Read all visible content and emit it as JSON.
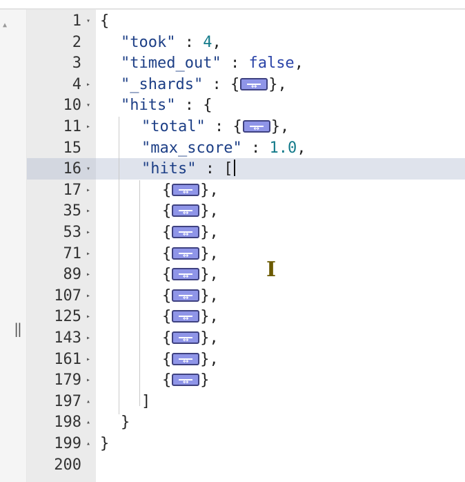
{
  "editor": {
    "lines": [
      {
        "num": "1",
        "fold": "▾",
        "indent": 0,
        "tokens": [
          {
            "t": "{",
            "c": "punc"
          }
        ]
      },
      {
        "num": "2",
        "fold": "",
        "indent": 1,
        "tokens": [
          {
            "t": "\"took\"",
            "c": "key"
          },
          {
            "t": " : ",
            "c": "punc"
          },
          {
            "t": "4",
            "c": "num"
          },
          {
            "t": ",",
            "c": "punc"
          }
        ]
      },
      {
        "num": "3",
        "fold": "",
        "indent": 1,
        "tokens": [
          {
            "t": "\"timed_out\"",
            "c": "key"
          },
          {
            "t": " : ",
            "c": "punc"
          },
          {
            "t": "false",
            "c": "kw"
          },
          {
            "t": ",",
            "c": "punc"
          }
        ]
      },
      {
        "num": "4",
        "fold": "▸",
        "indent": 1,
        "tokens": [
          {
            "t": "\"_shards\"",
            "c": "key"
          },
          {
            "t": " : ",
            "c": "punc"
          },
          {
            "t": "{",
            "c": "punc"
          },
          {
            "pill": true
          },
          {
            "t": "},",
            "c": "punc"
          }
        ]
      },
      {
        "num": "10",
        "fold": "▾",
        "indent": 1,
        "tokens": [
          {
            "t": "\"hits\"",
            "c": "key"
          },
          {
            "t": " : {",
            "c": "punc"
          }
        ]
      },
      {
        "num": "11",
        "fold": "▸",
        "indent": 2,
        "tokens": [
          {
            "t": "\"total\"",
            "c": "key"
          },
          {
            "t": " : ",
            "c": "punc"
          },
          {
            "t": "{",
            "c": "punc"
          },
          {
            "pill": true
          },
          {
            "t": "},",
            "c": "punc"
          }
        ]
      },
      {
        "num": "15",
        "fold": "",
        "indent": 2,
        "tokens": [
          {
            "t": "\"max_score\"",
            "c": "key"
          },
          {
            "t": " : ",
            "c": "punc"
          },
          {
            "t": "1.0",
            "c": "num"
          },
          {
            "t": ",",
            "c": "punc"
          }
        ]
      },
      {
        "num": "16",
        "fold": "▾",
        "indent": 2,
        "active": true,
        "tokens": [
          {
            "t": "\"hits\"",
            "c": "key"
          },
          {
            "t": " : [",
            "c": "punc"
          },
          {
            "cursor": true
          }
        ]
      },
      {
        "num": "17",
        "fold": "▸",
        "indent": 3,
        "tokens": [
          {
            "t": "{",
            "c": "punc"
          },
          {
            "pill": true
          },
          {
            "t": "},",
            "c": "punc"
          }
        ]
      },
      {
        "num": "35",
        "fold": "▸",
        "indent": 3,
        "tokens": [
          {
            "t": "{",
            "c": "punc"
          },
          {
            "pill": true
          },
          {
            "t": "},",
            "c": "punc"
          }
        ]
      },
      {
        "num": "53",
        "fold": "▸",
        "indent": 3,
        "tokens": [
          {
            "t": "{",
            "c": "punc"
          },
          {
            "pill": true
          },
          {
            "t": "},",
            "c": "punc"
          }
        ]
      },
      {
        "num": "71",
        "fold": "▸",
        "indent": 3,
        "tokens": [
          {
            "t": "{",
            "c": "punc"
          },
          {
            "pill": true
          },
          {
            "t": "},",
            "c": "punc"
          }
        ]
      },
      {
        "num": "89",
        "fold": "▸",
        "indent": 3,
        "tokens": [
          {
            "t": "{",
            "c": "punc"
          },
          {
            "pill": true
          },
          {
            "t": "},",
            "c": "punc"
          }
        ]
      },
      {
        "num": "107",
        "fold": "▸",
        "indent": 3,
        "tokens": [
          {
            "t": "{",
            "c": "punc"
          },
          {
            "pill": true
          },
          {
            "t": "},",
            "c": "punc"
          }
        ]
      },
      {
        "num": "125",
        "fold": "▸",
        "indent": 3,
        "tokens": [
          {
            "t": "{",
            "c": "punc"
          },
          {
            "pill": true
          },
          {
            "t": "},",
            "c": "punc"
          }
        ]
      },
      {
        "num": "143",
        "fold": "▸",
        "indent": 3,
        "tokens": [
          {
            "t": "{",
            "c": "punc"
          },
          {
            "pill": true
          },
          {
            "t": "},",
            "c": "punc"
          }
        ]
      },
      {
        "num": "161",
        "fold": "▸",
        "indent": 3,
        "tokens": [
          {
            "t": "{",
            "c": "punc"
          },
          {
            "pill": true
          },
          {
            "t": "},",
            "c": "punc"
          }
        ]
      },
      {
        "num": "179",
        "fold": "▸",
        "indent": 3,
        "tokens": [
          {
            "t": "{",
            "c": "punc"
          },
          {
            "pill": true
          },
          {
            "t": "}",
            "c": "punc"
          }
        ]
      },
      {
        "num": "197",
        "fold": "▴",
        "indent": 2,
        "tokens": [
          {
            "t": "]",
            "c": "punc"
          }
        ]
      },
      {
        "num": "198",
        "fold": "▴",
        "indent": 1,
        "tokens": [
          {
            "t": "}",
            "c": "punc"
          }
        ]
      },
      {
        "num": "199",
        "fold": "▴",
        "indent": 0,
        "tokens": [
          {
            "t": "}",
            "c": "punc"
          }
        ]
      },
      {
        "num": "200",
        "fold": "",
        "indent": 0,
        "tokens": []
      }
    ]
  },
  "colors": {
    "gutter_bg": "#ebebeb",
    "active_line": "#dfe3ec",
    "key": "#1d3f86",
    "number": "#137a8a",
    "boolean": "#2b44a8",
    "fold_pill": "#8f95e8"
  },
  "icons": {
    "scroll_up": "scroll-up-arrow-icon",
    "resizer": "panel-resizer-icon",
    "collapsed_object": "fold-ellipsis-icon",
    "text_cursor": "i-beam-cursor-icon"
  }
}
